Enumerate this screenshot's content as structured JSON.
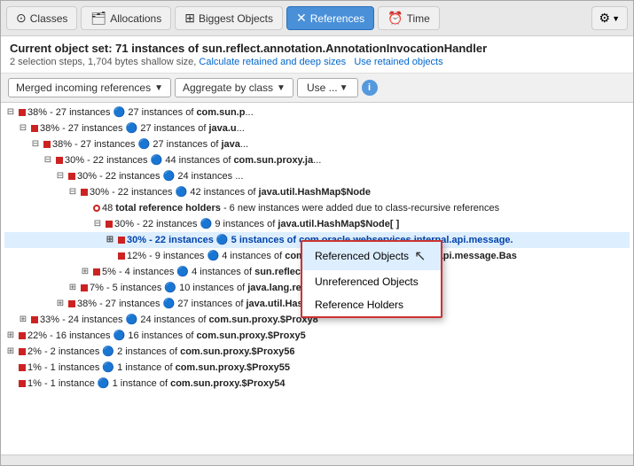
{
  "toolbar": {
    "tabs": [
      {
        "id": "classes",
        "label": "Classes",
        "icon": "⊙",
        "active": false
      },
      {
        "id": "allocations",
        "label": "Allocations",
        "icon": "🗂",
        "active": false
      },
      {
        "id": "biggest-objects",
        "label": "Biggest Objects",
        "icon": "⊞",
        "active": false
      },
      {
        "id": "references",
        "label": "References",
        "icon": "✕",
        "active": true
      },
      {
        "id": "time",
        "label": "Time",
        "icon": "⏰",
        "active": false
      }
    ],
    "gear_icon": "⚙"
  },
  "info_bar": {
    "title": "Current object set:  71 instances of sun.reflect.annotation.AnnotationInvocationHandler",
    "sub1": "2 selection steps,  1,704 bytes shallow size,",
    "link1": "Calculate retained and deep sizes",
    "link2": "Use retained objects"
  },
  "controls": {
    "merge_label": "Merged incoming references",
    "aggregate_label": "Aggregate by class",
    "use_label": "Use ...",
    "info_label": "i"
  },
  "dropdown_menu": {
    "items": [
      {
        "id": "referenced-objects",
        "label": "Referenced Objects",
        "selected": true
      },
      {
        "id": "unreferenced-objects",
        "label": "Unreferenced Objects",
        "selected": false
      },
      {
        "id": "reference-holders",
        "label": "Reference Holders",
        "selected": false
      }
    ]
  },
  "tree": {
    "rows": [
      {
        "indent": 0,
        "expand": "⊟",
        "marker": "red-square",
        "text": "38% - 27 instances 🟢 27 instances of com.sun.p..."
      },
      {
        "indent": 1,
        "expand": "⊟",
        "marker": "red-square",
        "text": "38% - 27 instances 🟢 27 instances of java.u..."
      },
      {
        "indent": 2,
        "expand": "⊟",
        "marker": "red-square",
        "text": "38% - 27 instances 🟢 27 instances of java..."
      },
      {
        "indent": 3,
        "expand": "⊟",
        "marker": "red-square",
        "text": "30% - 22 instances 🟢 44 instances of com.sun.proxy.ja..."
      },
      {
        "indent": 4,
        "expand": "⊟",
        "marker": "red-square",
        "text": "30% - 22 instances 🟢 24 instances ..."
      },
      {
        "indent": 5,
        "expand": "⊟",
        "marker": "red-square",
        "text": "30% - 22 instances 🟢 42 instances of java.util.HashMap$Node"
      },
      {
        "indent": 6,
        "expand": "",
        "marker": "red-circle",
        "text": "48 total reference holders - 6 new instances were added due to class-recursive references"
      },
      {
        "indent": 7,
        "expand": "⊟",
        "marker": "red-square",
        "text": "30% - 22 instances 🟢 9 instances of java.util.HashMap$Node[ ]"
      },
      {
        "indent": 8,
        "expand": "⊞",
        "marker": "red-square",
        "text": "30% - 22 instances 🟢 5 instances of com.oracle.webservices.internal.api.message.",
        "bold": true,
        "highlight": true
      },
      {
        "indent": 8,
        "expand": "",
        "marker": "red-square",
        "text": "12% - 9 instances 🟢 4 instances of com.oracle.webservices.internal.api.message.Bas"
      },
      {
        "indent": 6,
        "expand": "⊞",
        "marker": "red-square",
        "text": "5% - 4 instances 🟢 4 instances of sun.reflect.NativeMethodAccessorImpl"
      },
      {
        "indent": 5,
        "expand": "⊞",
        "marker": "red-square",
        "text": "7% - 5 instances 🟢 10 instances of java.lang.reflect.Field"
      },
      {
        "indent": 4,
        "expand": "⊞",
        "marker": "red-square",
        "text": "38% - 27 instances 🟢 27 instances of java.util.HashMap$Node[ ]"
      },
      {
        "indent": 1,
        "expand": "⊞",
        "marker": "red-square",
        "text": "33% - 24 instances 🟢 24 instances of com.sun.proxy.$Proxy8"
      },
      {
        "indent": 0,
        "expand": "⊞",
        "marker": "red-square",
        "text": "22% - 16 instances 🟢 16 instances of com.sun.proxy.$Proxy5"
      },
      {
        "indent": 0,
        "expand": "⊞",
        "marker": "red-square",
        "text": "2% - 2 instances 🟢 2 instances of com.sun.proxy.$Proxy56"
      },
      {
        "indent": 0,
        "expand": "",
        "marker": "red-square",
        "text": "1% - 1 instances 🟢 1 instance of com.sun.proxy.$Proxy55"
      },
      {
        "indent": 0,
        "expand": "",
        "marker": "red-square",
        "text": "1% - 1 instance 🟢 1 instance of com.sun.proxy.$Proxy54"
      }
    ]
  }
}
